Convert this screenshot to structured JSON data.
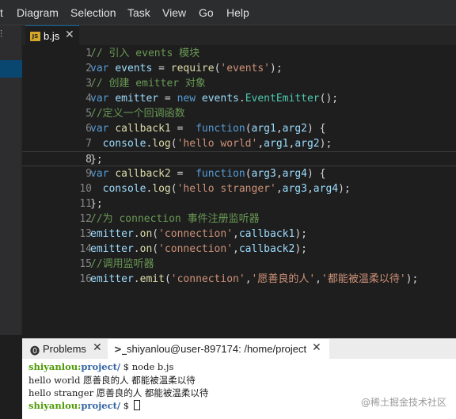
{
  "menubar": {
    "items": [
      "t",
      "Diagram",
      "Selection",
      "Task",
      "View",
      "Go",
      "Help"
    ]
  },
  "sidebar": {
    "icon_glyph": "⫶"
  },
  "tab": {
    "icon_text": "JS",
    "label": "b.js",
    "close_glyph": "✕"
  },
  "editor": {
    "active_line": 8,
    "lines": [
      {
        "n": "1",
        "tokens": [
          {
            "t": "comment",
            "v": "// 引入 events 模块"
          }
        ]
      },
      {
        "n": "2",
        "tokens": [
          {
            "t": "keyword",
            "v": "var"
          },
          {
            "t": "punct",
            "v": " "
          },
          {
            "t": "ident",
            "v": "events"
          },
          {
            "t": "punct",
            "v": " = "
          },
          {
            "t": "func",
            "v": "require"
          },
          {
            "t": "punct",
            "v": "("
          },
          {
            "t": "string",
            "v": "'events'"
          },
          {
            "t": "punct",
            "v": ");"
          }
        ]
      },
      {
        "n": "3",
        "tokens": [
          {
            "t": "comment",
            "v": "// 创建 emitter 对象"
          }
        ]
      },
      {
        "n": "4",
        "tokens": [
          {
            "t": "keyword",
            "v": "var"
          },
          {
            "t": "punct",
            "v": " "
          },
          {
            "t": "ident",
            "v": "emitter"
          },
          {
            "t": "punct",
            "v": " = "
          },
          {
            "t": "keyword",
            "v": "new"
          },
          {
            "t": "punct",
            "v": " "
          },
          {
            "t": "ident",
            "v": "events"
          },
          {
            "t": "punct",
            "v": "."
          },
          {
            "t": "type",
            "v": "EventEmitter"
          },
          {
            "t": "punct",
            "v": "();"
          }
        ]
      },
      {
        "n": "5",
        "tokens": [
          {
            "t": "comment",
            "v": "//定义一个回调函数"
          }
        ]
      },
      {
        "n": "6",
        "tokens": [
          {
            "t": "keyword",
            "v": "var"
          },
          {
            "t": "punct",
            "v": " "
          },
          {
            "t": "func",
            "v": "callback1"
          },
          {
            "t": "punct",
            "v": " =  "
          },
          {
            "t": "keyword",
            "v": "function"
          },
          {
            "t": "punct",
            "v": "("
          },
          {
            "t": "ident",
            "v": "arg1"
          },
          {
            "t": "punct",
            "v": ","
          },
          {
            "t": "ident",
            "v": "arg2"
          },
          {
            "t": "punct",
            "v": ") {"
          }
        ]
      },
      {
        "n": "7",
        "tokens": [
          {
            "t": "punct",
            "v": "  "
          },
          {
            "t": "ident",
            "v": "console"
          },
          {
            "t": "punct",
            "v": "."
          },
          {
            "t": "func",
            "v": "log"
          },
          {
            "t": "punct",
            "v": "("
          },
          {
            "t": "string",
            "v": "'hello world'"
          },
          {
            "t": "punct",
            "v": ","
          },
          {
            "t": "ident",
            "v": "arg1"
          },
          {
            "t": "punct",
            "v": ","
          },
          {
            "t": "ident",
            "v": "arg2"
          },
          {
            "t": "punct",
            "v": ");"
          }
        ]
      },
      {
        "n": "8",
        "tokens": [
          {
            "t": "punct",
            "v": "};"
          }
        ]
      },
      {
        "n": "9",
        "tokens": [
          {
            "t": "keyword",
            "v": "var"
          },
          {
            "t": "punct",
            "v": " "
          },
          {
            "t": "func",
            "v": "callback2"
          },
          {
            "t": "punct",
            "v": " =  "
          },
          {
            "t": "keyword",
            "v": "function"
          },
          {
            "t": "punct",
            "v": "("
          },
          {
            "t": "ident",
            "v": "arg3"
          },
          {
            "t": "punct",
            "v": ","
          },
          {
            "t": "ident",
            "v": "arg4"
          },
          {
            "t": "punct",
            "v": ") {"
          }
        ]
      },
      {
        "n": "10",
        "tokens": [
          {
            "t": "punct",
            "v": "  "
          },
          {
            "t": "ident",
            "v": "console"
          },
          {
            "t": "punct",
            "v": "."
          },
          {
            "t": "func",
            "v": "log"
          },
          {
            "t": "punct",
            "v": "("
          },
          {
            "t": "string",
            "v": "'hello stranger'"
          },
          {
            "t": "punct",
            "v": ","
          },
          {
            "t": "ident",
            "v": "arg3"
          },
          {
            "t": "punct",
            "v": ","
          },
          {
            "t": "ident",
            "v": "arg4"
          },
          {
            "t": "punct",
            "v": ");"
          }
        ]
      },
      {
        "n": "11",
        "tokens": [
          {
            "t": "punct",
            "v": "};"
          }
        ]
      },
      {
        "n": "12",
        "tokens": [
          {
            "t": "comment",
            "v": "//为 connection 事件注册监听器"
          }
        ]
      },
      {
        "n": "13",
        "tokens": [
          {
            "t": "ident",
            "v": "emitter"
          },
          {
            "t": "punct",
            "v": "."
          },
          {
            "t": "func",
            "v": "on"
          },
          {
            "t": "punct",
            "v": "("
          },
          {
            "t": "string",
            "v": "'connection'"
          },
          {
            "t": "punct",
            "v": ","
          },
          {
            "t": "ident",
            "v": "callback1"
          },
          {
            "t": "punct",
            "v": ");"
          }
        ]
      },
      {
        "n": "14",
        "tokens": [
          {
            "t": "ident",
            "v": "emitter"
          },
          {
            "t": "punct",
            "v": "."
          },
          {
            "t": "func",
            "v": "on"
          },
          {
            "t": "punct",
            "v": "("
          },
          {
            "t": "string",
            "v": "'connection'"
          },
          {
            "t": "punct",
            "v": ","
          },
          {
            "t": "ident",
            "v": "callback2"
          },
          {
            "t": "punct",
            "v": ");"
          }
        ]
      },
      {
        "n": "15",
        "tokens": [
          {
            "t": "comment",
            "v": "//调用监听器"
          }
        ]
      },
      {
        "n": "16",
        "tokens": [
          {
            "t": "ident",
            "v": "emitter"
          },
          {
            "t": "punct",
            "v": "."
          },
          {
            "t": "func",
            "v": "emit"
          },
          {
            "t": "punct",
            "v": "("
          },
          {
            "t": "string",
            "v": "'connection'"
          },
          {
            "t": "punct",
            "v": ","
          },
          {
            "t": "string",
            "v": "'愿善良的人'"
          },
          {
            "t": "punct",
            "v": ","
          },
          {
            "t": "string",
            "v": "'都能被温柔以待'"
          },
          {
            "t": "punct",
            "v": ");"
          }
        ]
      }
    ]
  },
  "panel": {
    "problems_icon": "⓿",
    "problems_label": "Problems",
    "terminal_icon": ">_",
    "terminal_label": "shiyanlou@user-897174: /home/project",
    "close_glyph": "✕"
  },
  "terminal": {
    "prompt_user": "shiyanlou:",
    "prompt_path": "project/",
    "prompt_symbol": " $ ",
    "command": "node b.js",
    "output1": "hello world 愿善良的人 都能被温柔以待",
    "output2": "hello stranger 愿善良的人 都能被温柔以待",
    "watermark": "@稀土掘金技术社区"
  }
}
